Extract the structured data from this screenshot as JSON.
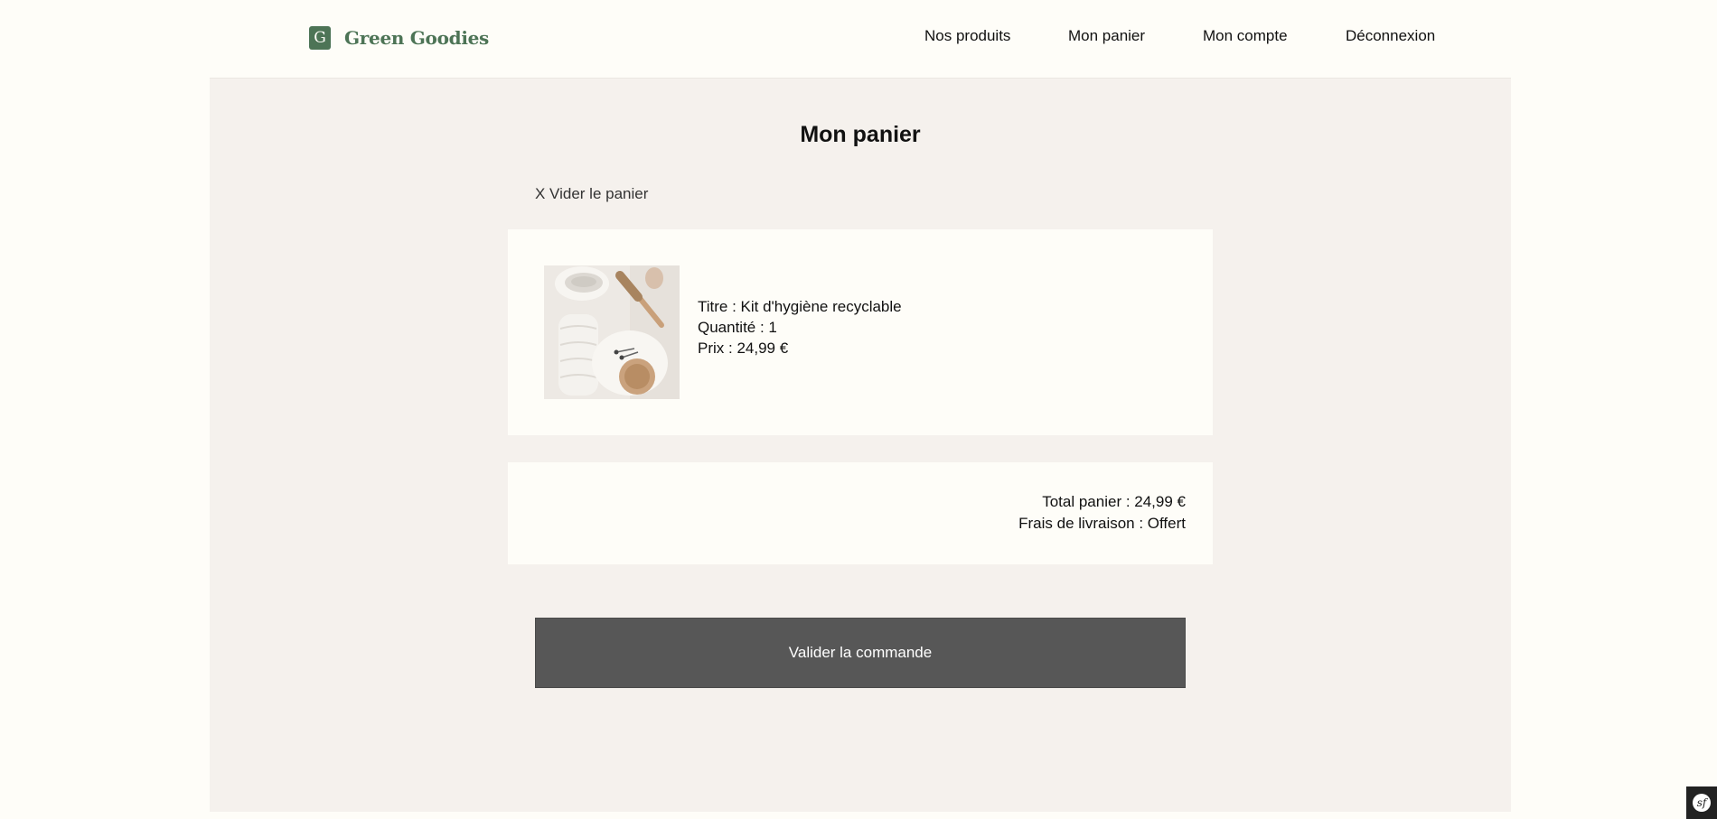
{
  "header": {
    "logo_letter": "G",
    "brand_name": "Green Goodies",
    "nav": [
      {
        "label": "Nos produits"
      },
      {
        "label": "Mon panier"
      },
      {
        "label": "Mon compte"
      },
      {
        "label": "Déconnexion"
      }
    ]
  },
  "cart": {
    "title": "Mon panier",
    "clear_label": "X Vider le panier",
    "items": [
      {
        "title_line": "Titre : Kit d'hygiène recyclable",
        "quantity_line": "Quantité : 1",
        "price_line": "Prix : 24,99 €",
        "image_icon": "hygiene-kit-photo"
      }
    ],
    "summary": {
      "total_line": "Total panier : 24,99 €",
      "shipping_line": "Frais de livraison : Offert"
    },
    "validate_label": "Valider la commande"
  },
  "debug_toolbar": {
    "icon": "symfony-icon",
    "glyph": "sf"
  },
  "colors": {
    "brand_green": "#4d7456",
    "page_bg": "#fefdf8",
    "panel_bg": "#f5f1ed",
    "button_bg": "#575757"
  }
}
